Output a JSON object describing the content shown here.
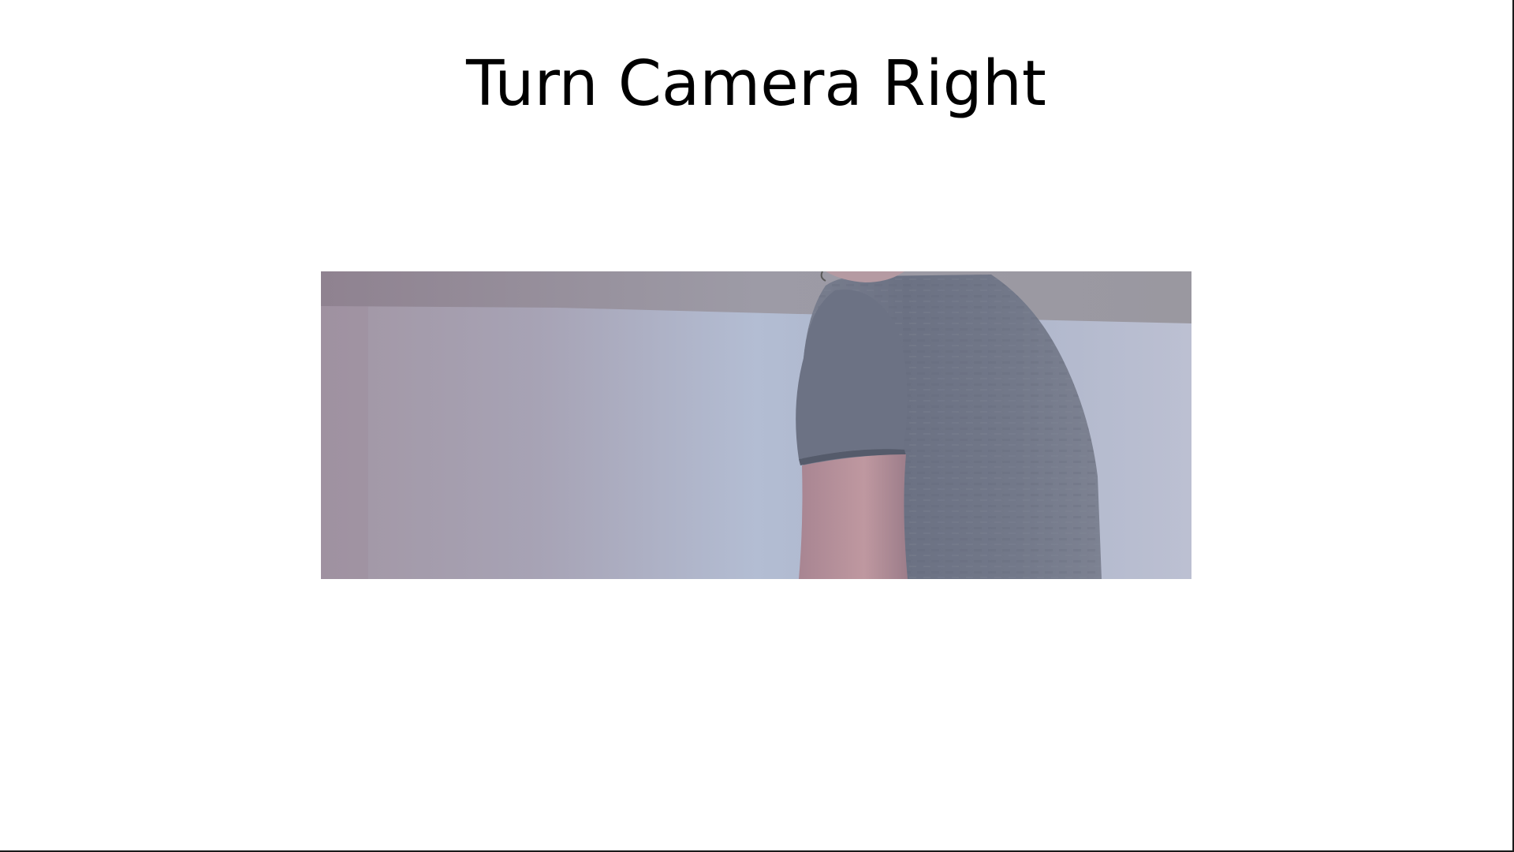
{
  "screen": {
    "title": "Turn Camera Right"
  },
  "camera_feed": {
    "scene": "person-in-grey-tshirt-cropped-right",
    "colors": {
      "wall": "#b0b6cc",
      "ceiling": "#97929b",
      "shirt": "#6f7585",
      "skin": "#b89098"
    }
  }
}
